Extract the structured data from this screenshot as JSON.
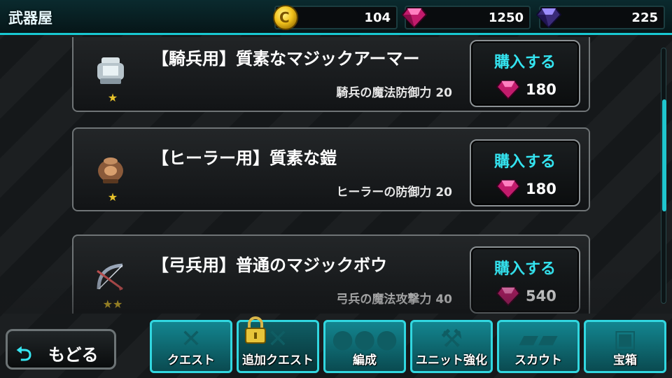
{
  "header": {
    "title": "武器屋",
    "coins": "104",
    "red_gems": "1250",
    "blue_gems": "225"
  },
  "items": [
    {
      "name": "【騎兵用】質素なマジックアーマー",
      "stat": "騎兵の魔法防御力 20",
      "stars": "★",
      "buy_label": "購入する",
      "price": "180",
      "icon": "armor-icon"
    },
    {
      "name": "【ヒーラー用】質素な鎧",
      "stat": "ヒーラーの防御力 20",
      "stars": "★",
      "buy_label": "購入する",
      "price": "180",
      "icon": "pot-armor-icon"
    },
    {
      "name": "【弓兵用】普通のマジックボウ",
      "stat": "弓兵の魔法攻撃力 40",
      "stars": "★★",
      "buy_label": "購入する",
      "price": "540",
      "icon": "bow-icon"
    }
  ],
  "nav": {
    "back_label": "もどる",
    "buttons": [
      {
        "label": "クエスト",
        "icon": "sword-cross-icon"
      },
      {
        "label": "追加クエスト",
        "icon": "locked-quest-icon"
      },
      {
        "label": "編成",
        "icon": "party-icon"
      },
      {
        "label": "ユニット強化",
        "icon": "wrench-hammer-icon"
      },
      {
        "label": "スカウト",
        "icon": "scout-cards-icon"
      },
      {
        "label": "宝箱",
        "icon": "treasure-chest-icon"
      }
    ]
  },
  "colors": {
    "accent": "#1fc7cf",
    "buy_text": "#34e4f0",
    "star": "#e8c32a"
  }
}
